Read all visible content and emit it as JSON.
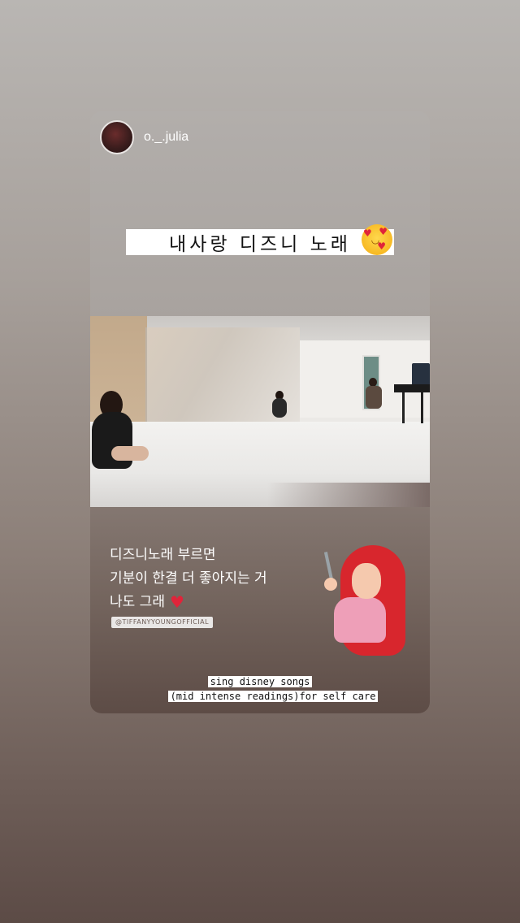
{
  "story": {
    "username": "o._.julia",
    "title_sticker": "내사랑 디즈니 노래",
    "title_emoji": "smiling-face-with-hearts-icon",
    "caption": {
      "line1": "디즈니노래 부르면",
      "line2": "기분이 한결 더 좋아지는 거",
      "line3": "나도 그래",
      "heart_icon": "red-heart-icon"
    },
    "mention": "@TIFFANYYOUNGOFFICIAL",
    "sticker": "ariel-sticker",
    "bottom_text": {
      "line1": "sing disney songs",
      "line2": "(mid intense readings)for self care"
    }
  },
  "colors": {
    "heart": "#e0243a",
    "sticker_bg": "#ffffff"
  }
}
